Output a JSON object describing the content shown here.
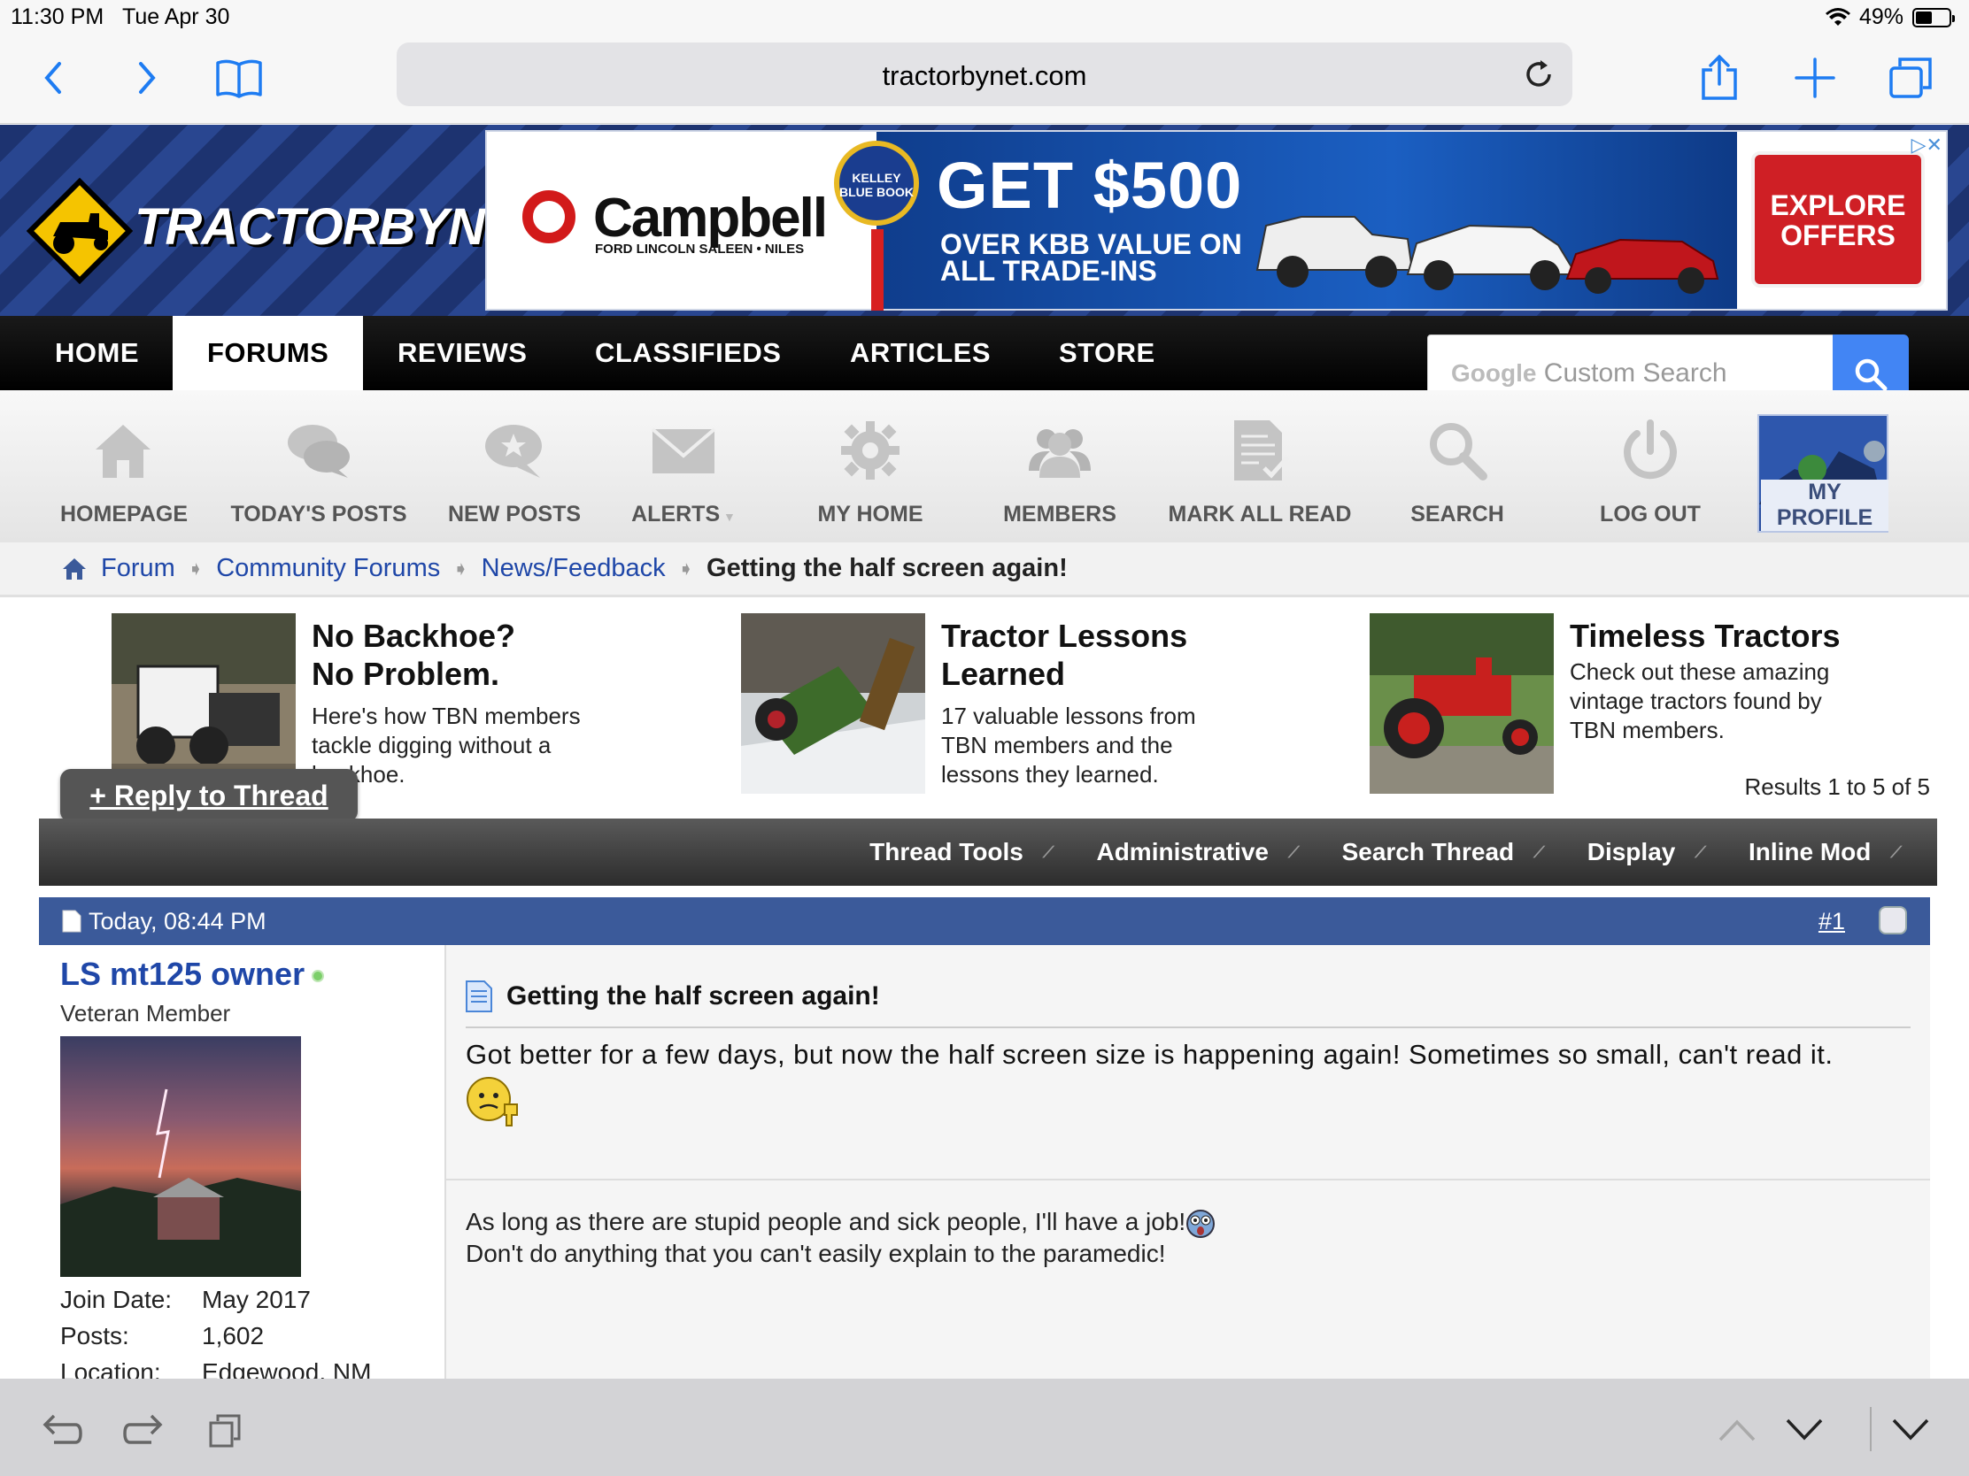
{
  "status": {
    "time": "11:30 PM",
    "date": "Tue Apr 30",
    "battery": "49%",
    "battery_level": 0.49
  },
  "browser": {
    "url": "tractorbynet.com"
  },
  "site": {
    "logo_part1": "TRACTOR",
    "logo_part2": "BYNET"
  },
  "ad": {
    "brand": "Campbell",
    "brand_sub": "FORD LINCOLN  SALEEN • NILES",
    "badge": "KELLEY BLUE BOOK",
    "headline": "GET $500",
    "sub1": "OVER KBB VALUE ON",
    "sub2": "ALL TRADE-INS",
    "cta1": "EXPLORE",
    "cta2": "OFFERS"
  },
  "nav": {
    "items": [
      "HOME",
      "FORUMS",
      "REVIEWS",
      "CLASSIFIEDS",
      "ARTICLES",
      "STORE"
    ],
    "active": "FORUMS",
    "search_brand": "Google",
    "search_placeholder": "Custom Search"
  },
  "toolbar": {
    "items": [
      "HOMEPAGE",
      "TODAY'S POSTS",
      "NEW POSTS",
      "ALERTS",
      "MY HOME",
      "MEMBERS",
      "MARK ALL READ",
      "SEARCH",
      "LOG OUT",
      "MY PROFILE"
    ]
  },
  "breadcrumb": {
    "items": [
      "Forum",
      "Community Forums",
      "News/Feedback"
    ],
    "current": "Getting the half screen again!"
  },
  "promos": [
    {
      "title1": "No Backhoe?",
      "title2": "No Problem.",
      "desc": [
        "Here's how TBN members",
        "tackle digging without a",
        "backhoe."
      ]
    },
    {
      "title1": "Tractor Lessons",
      "title2": "Learned",
      "desc": [
        "17 valuable lessons from",
        "TBN members and the",
        "lessons they learned."
      ]
    },
    {
      "title1": "Timeless Tractors",
      "title2": "",
      "desc": [
        "Check out these amazing",
        "vintage tractors found by",
        "TBN members."
      ]
    }
  ],
  "thread": {
    "reply_label": "+ Reply to Thread",
    "results": "Results 1 to 5 of 5",
    "tools": [
      "Thread Tools",
      "Administrative",
      "Search Thread",
      "Display",
      "Inline Mod"
    ]
  },
  "post": {
    "date": "Today, 08:44 PM",
    "number": "#1",
    "title": "Getting the half screen again!",
    "message": "Got better for a few days, but now the half screen size is happening again! Sometimes so small, can't read it.",
    "signature1": "As long as there are stupid people and sick people, I'll have a job!",
    "signature2": "Don't do anything that you can't easily explain to the paramedic!"
  },
  "user": {
    "name": "LS mt125 owner",
    "rank": "Veteran Member",
    "join_label": "Join Date:",
    "join_value": "May 2017",
    "posts_label": "Posts:",
    "posts_value": "1,602",
    "location_label": "Location:",
    "location_value": "Edgewood, NM"
  },
  "colors": {
    "nav_bg": "#000000",
    "link": "#1f47a8",
    "post_header": "#3b5a9a",
    "safari_blue": "#1e7cf2",
    "google_blue": "#4285f4"
  }
}
